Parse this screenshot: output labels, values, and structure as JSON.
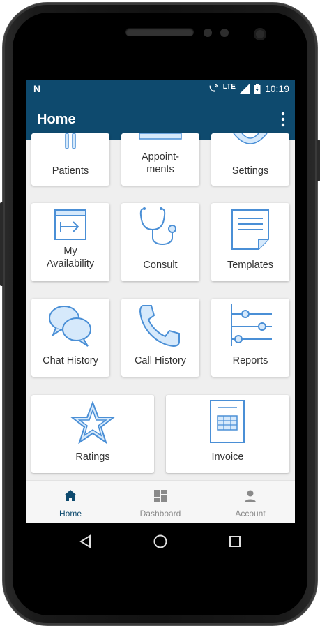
{
  "statusbar": {
    "left_icon": "n-notification-icon",
    "network": "LTE",
    "time": "10:19"
  },
  "appbar": {
    "title": "Home",
    "menu_icon": "more-vert-icon"
  },
  "tiles": [
    {
      "label": "Patients",
      "icon": "patients-icon"
    },
    {
      "label": "Appoint-\nments",
      "icon": "appointments-icon"
    },
    {
      "label": "Settings",
      "icon": "gear-icon"
    },
    {
      "label": "My\nAvailability",
      "icon": "availability-icon"
    },
    {
      "label": "Consult",
      "icon": "stethoscope-icon"
    },
    {
      "label": "Templates",
      "icon": "template-icon"
    },
    {
      "label": "Chat History",
      "icon": "chat-icon"
    },
    {
      "label": "Call History",
      "icon": "phone-icon"
    },
    {
      "label": "Reports",
      "icon": "sliders-icon"
    },
    {
      "label": "Ratings",
      "icon": "star-icon"
    },
    {
      "label": "Invoice",
      "icon": "invoice-icon"
    }
  ],
  "bottom_nav": [
    {
      "label": "Home",
      "icon": "home-icon",
      "active": true
    },
    {
      "label": "Dashboard",
      "icon": "dashboard-icon",
      "active": false
    },
    {
      "label": "Account",
      "icon": "person-icon",
      "active": false
    }
  ],
  "colors": {
    "primary": "#0e4a6e",
    "icon_blue": "#4a8fd6",
    "icon_fill": "#d6e9fb",
    "active_nav": "#0e4a6e",
    "inactive_nav": "#8a8a8a"
  }
}
